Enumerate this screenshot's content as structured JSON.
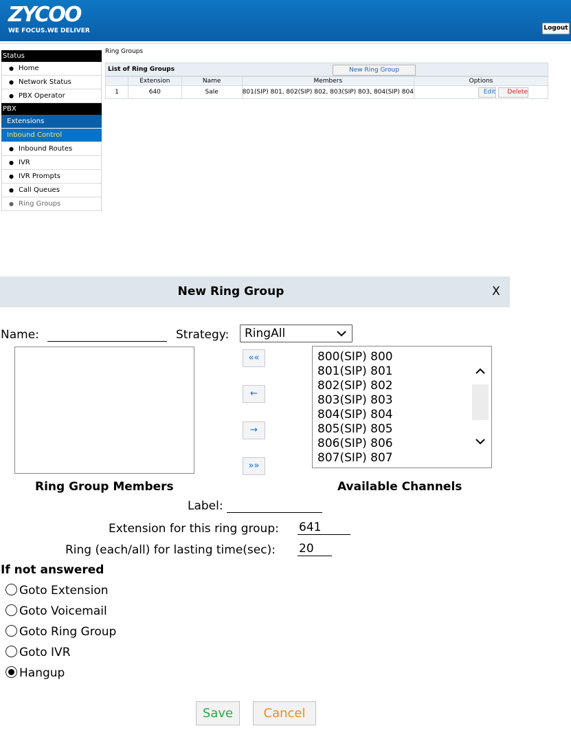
{
  "header": {
    "logo_text": "ZYCOO",
    "tagline": "WE FOCUS.WE DELIVER",
    "logout_label": "Logout",
    "bg_color": "#0b64ae"
  },
  "sidebar": {
    "status_section": "Status",
    "status_items": [
      "Home",
      "Network Status",
      "PBX Operator"
    ],
    "pbx_section": "PBX",
    "categories": [
      "Extensions",
      "Inbound Control"
    ],
    "active_category": "Inbound Control",
    "inbound_items": [
      "Inbound Routes",
      "IVR",
      "IVR Prompts",
      "Call Queues",
      "Ring Groups"
    ],
    "active_item": "Ring Groups"
  },
  "main": {
    "breadcrumb": "Ring Groups",
    "list_title": "List of Ring Groups",
    "new_button_label": "New Ring Group",
    "columns": [
      "",
      "Extension",
      "Name",
      "Members",
      "Options"
    ],
    "rows": [
      {
        "index": "1",
        "extension": "640",
        "name": "Sale",
        "members": "801(SIP) 801, 802(SIP) 802, 803(SIP) 803, 804(SIP) 804",
        "edit_label": "Edit",
        "delete_label": "Delete"
      }
    ]
  },
  "dialog": {
    "title": "New Ring Group",
    "close_label": "X",
    "name_label": "Name:",
    "name_value": "",
    "strategy_label": "Strategy:",
    "strategy_value": "RingAll",
    "move_buttons": [
      "««",
      "←",
      "→",
      "»»"
    ],
    "members_caption": "Ring Group Members",
    "available_caption": "Available Channels",
    "available_channels": [
      "800(SIP) 800",
      "801(SIP) 801",
      "802(SIP) 802",
      "803(SIP) 803",
      "804(SIP) 804",
      "805(SIP) 805",
      "806(SIP) 806",
      "807(SIP) 807"
    ],
    "label_label": "Label:",
    "label_value": "",
    "extension_label": "Extension for this ring group:",
    "extension_value": "641",
    "ring_time_label": "Ring (each/all) for lasting time(sec):",
    "ring_time_value": "20",
    "unanswered_heading": "If not answered",
    "unanswered_options": [
      "Goto Extension",
      "Goto Voicemail",
      "Goto Ring Group",
      "Goto IVR",
      "Hangup"
    ],
    "unanswered_selected": "Hangup",
    "save_label": "Save",
    "cancel_label": "Cancel"
  }
}
